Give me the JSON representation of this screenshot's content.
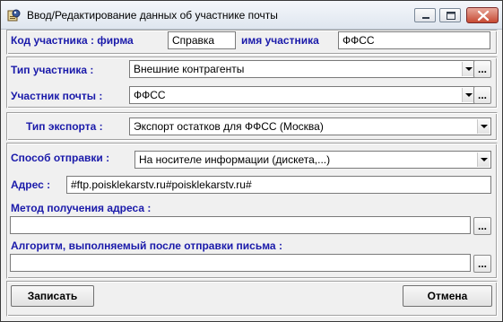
{
  "window": {
    "title": "Ввод/Редактирование данных об участнике почты",
    "icon": "app-icon"
  },
  "participant": {
    "code_label": "Код участника : фирма",
    "code_value": "Справка",
    "name_label": "имя участника",
    "name_value": "ФФСС"
  },
  "type": {
    "type_label": "Тип участника :",
    "type_value": "Внешние контрагенты",
    "mail_label": "Участник почты :",
    "mail_value": "ФФСС",
    "browse_label": "..."
  },
  "export": {
    "label": "Тип экспорта :",
    "value": "Экспорт остатков для ФФСС (Москва)"
  },
  "send": {
    "method_label": "Способ отправки :",
    "method_value": "На носителе информации (дискета,...)",
    "address_label": "Адрес :",
    "address_value": "#ftp.poisklekarstv.ru#poisklekarstv.ru#",
    "addr_method_label": "Метод получения адреса :",
    "addr_method_value": "",
    "algorithm_label": "Алгоритм, выполняемый после отправки письма :",
    "algorithm_value": "",
    "browse_label": "..."
  },
  "buttons": {
    "save_label": "Записать",
    "cancel_label": "Отмена"
  },
  "colors": {
    "label_blue": "#1a1aaa",
    "face": "#f0f0f0",
    "close_red": "#c74a33"
  }
}
